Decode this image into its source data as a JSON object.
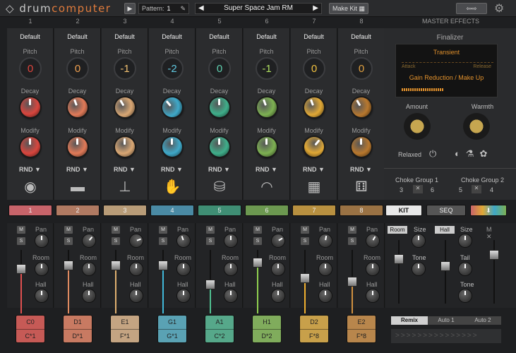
{
  "app": {
    "logo_a": "drum",
    "logo_b": "computer",
    "pattern_label": "Pattern:",
    "pattern_value": "1",
    "preset": "Super Space Jam RM",
    "make_kit": "Make Kit"
  },
  "channels": [
    {
      "num": "1",
      "name": "Default",
      "pitch": "0",
      "color": "#d8463e",
      "pc": "#e0453d",
      "tab": "1",
      "tabc": "#c8646a",
      "pad_top": "C0",
      "pad_bot": "C*1",
      "padc": "#c65a56",
      "fadc": "#e05050",
      "icon": "kick-drum-icon",
      "glyph": "◉"
    },
    {
      "num": "2",
      "name": "Default",
      "pitch": "0",
      "color": "#e07a58",
      "pc": "#f0a050",
      "tab": "2",
      "tabc": "#b07a62",
      "pad_top": "D1",
      "pad_bot": "D*1",
      "padc": "#c87a62",
      "fadc": "#e08a60",
      "icon": "snare-drum-icon",
      "glyph": "▬"
    },
    {
      "num": "3",
      "name": "Default",
      "pitch": "-1",
      "color": "#d9a774",
      "pc": "#f0c070",
      "tab": "3",
      "tabc": "#b89c78",
      "pad_top": "E1",
      "pad_bot": "F*1",
      "padc": "#c4a482",
      "fadc": "#e0b070",
      "icon": "cymbal-icon",
      "glyph": "⊥"
    },
    {
      "num": "4",
      "name": "Default",
      "pitch": "-2",
      "color": "#3fa8c8",
      "pc": "#60c8e0",
      "tab": "4",
      "tabc": "#4a8aa4",
      "pad_top": "G1",
      "pad_bot": "G*1",
      "padc": "#5aa2b4",
      "fadc": "#40b8d8",
      "icon": "clap-icon",
      "glyph": "✋"
    },
    {
      "num": "5",
      "name": "Default",
      "pitch": "0",
      "color": "#3fae8a",
      "pc": "#60d0b0",
      "tab": "5",
      "tabc": "#3f8e74",
      "pad_top": "A1",
      "pad_bot": "C*2",
      "padc": "#56a88a",
      "fadc": "#50c090",
      "icon": "conga-icon",
      "glyph": "⛁"
    },
    {
      "num": "6",
      "name": "Default",
      "pitch": "-1",
      "color": "#7db052",
      "pc": "#b0e060",
      "tab": "6",
      "tabc": "#6c9850",
      "pad_top": "H1",
      "pad_bot": "D*2",
      "padc": "#80ac5c",
      "fadc": "#90d050",
      "icon": "ride-cymbal-icon",
      "glyph": "◠"
    },
    {
      "num": "7",
      "name": "Default",
      "pitch": "0",
      "color": "#e0a836",
      "pc": "#f0c040",
      "tab": "7",
      "tabc": "#b89040",
      "pad_top": "D2",
      "pad_bot": "F*8",
      "padc": "#c8a04a",
      "fadc": "#f0b030",
      "icon": "keyboard-icon",
      "glyph": "▦"
    },
    {
      "num": "8",
      "name": "Default",
      "pitch": "0",
      "color": "#b8782e",
      "pc": "#e0a040",
      "tab": "8",
      "tabc": "#9a7244",
      "pad_top": "E2",
      "pad_bot": "F*8",
      "padc": "#b8864c",
      "fadc": "#d09040",
      "icon": "dice-icon",
      "glyph": "⚅"
    }
  ],
  "labels": {
    "pitch": "Pitch",
    "decay": "Decay",
    "modify": "Modify",
    "rnd": "RND ▼",
    "m": "M",
    "s": "S",
    "pan": "Pan",
    "room": "Room",
    "hall": "Hall"
  },
  "master": {
    "title": "MASTER EFFECTS",
    "finalizer": "Finalizer",
    "transient": "Transient",
    "attack": "Attack",
    "release": "Release",
    "gain": "Gain Reduction / Make Up",
    "amount": "Amount",
    "warmth": "Warmth",
    "relaxed": "Relaxed",
    "choke1": "Choke Group 1",
    "choke1_a": "3",
    "choke1_b": "6",
    "choke2": "Choke Group 2",
    "choke2_a": "5",
    "choke2_b": "4"
  },
  "tabs": {
    "kit": "KIT",
    "seq": "SEQ"
  },
  "fx": {
    "room": "Room",
    "hall": "Hall",
    "size": "Size",
    "tone": "Tone",
    "tail": "Tail",
    "remix": "Remix",
    "auto1": "Auto 1",
    "auto2": "Auto 2"
  }
}
